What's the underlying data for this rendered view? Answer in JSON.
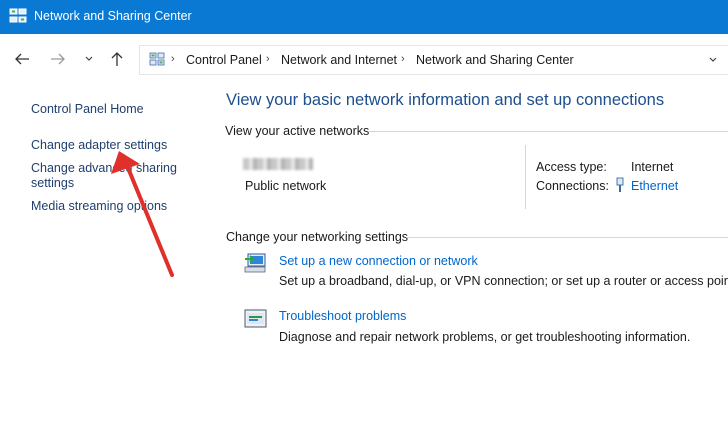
{
  "window": {
    "title": "Network and Sharing Center"
  },
  "address_bar": {
    "breadcrumbs": [
      "Control Panel",
      "Network and Internet",
      "Network and Sharing Center"
    ]
  },
  "sidebar": {
    "items": [
      {
        "label": "Control Panel Home"
      },
      {
        "label": "Change adapter settings"
      },
      {
        "label": "Change advanced sharing"
      },
      {
        "label": "settings"
      },
      {
        "label": "Media streaming options"
      }
    ]
  },
  "main": {
    "heading": "View your basic network information and set up connections",
    "active_networks": {
      "section_label": "View your active networks",
      "network_type": "Public network",
      "access_type_label": "Access type:",
      "access_type_value": "Internet",
      "connections_label": "Connections:",
      "connections_value": "Ethernet"
    },
    "networking_settings": {
      "section_label": "Change your networking settings",
      "items": [
        {
          "title": "Set up a new connection or network",
          "description": "Set up a broadband, dial-up, or VPN connection; or set up a router or access point."
        },
        {
          "title": "Troubleshoot problems",
          "description": "Diagnose and repair network problems, or get troubleshooting information."
        }
      ]
    }
  },
  "colors": {
    "titlebar": "#0a79d4",
    "link": "#0066cc",
    "sidebar_link": "#1f3f6e",
    "heading": "#1e4e8c",
    "annotation_arrow": "#e0302b"
  },
  "icons": {
    "app": "network-center-icon",
    "back": "back-arrow-icon",
    "forward": "forward-arrow-icon",
    "recent": "chevron-down-icon",
    "up": "up-arrow-icon",
    "connections": "ethernet-plug-icon",
    "new_connection": "network-setup-icon",
    "troubleshoot": "troubleshoot-icon"
  }
}
